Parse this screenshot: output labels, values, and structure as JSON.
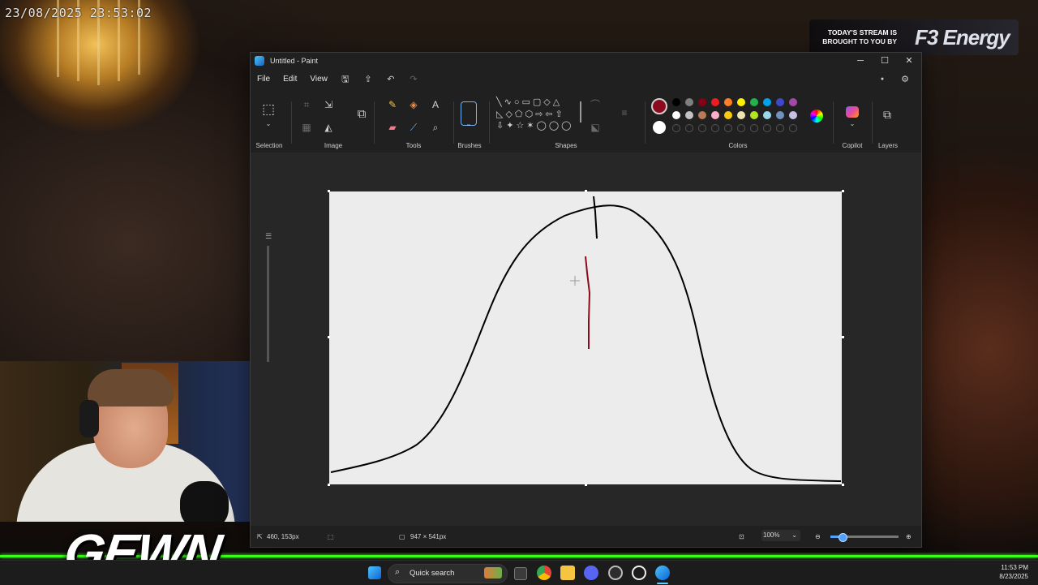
{
  "overlay": {
    "timestamp": "23/08/2025 23:53:02",
    "sponsor_text": "TODAY'S STREAM IS BROUGHT TO YOU BY",
    "sponsor_logo": "F3 Energy",
    "brand": "GEWN",
    "accent_color": "#39ff14"
  },
  "window": {
    "title": "Untitled - Paint",
    "controls": {
      "minimize": "─",
      "maximize": "☐",
      "close": "✕"
    }
  },
  "menu": {
    "items": [
      "File",
      "Edit",
      "View"
    ],
    "quick_actions": [
      "save-icon",
      "share-icon",
      "undo-icon",
      "redo-icon"
    ],
    "right": [
      "account-icon",
      "settings-icon"
    ]
  },
  "ribbon": {
    "groups": {
      "selection": "Selection",
      "image": "Image",
      "tools": "Tools",
      "brushes": "Brushes",
      "shapes": "Shapes",
      "colors": "Colors",
      "copilot": "Copilot",
      "layers": "Layers"
    },
    "active_color": "#8b0a1e",
    "secondary_color": "#ffffff",
    "palette_row1": [
      "#000000",
      "#7f7f7f",
      "#880015",
      "#ed1c24",
      "#ff7f27",
      "#fff200",
      "#22b14c",
      "#00a2e8",
      "#3f48cc",
      "#a349a4"
    ],
    "palette_row2": [
      "#ffffff",
      "#c3c3c3",
      "#b97a57",
      "#ffaec9",
      "#ffc90e",
      "#efe4b0",
      "#b5e61d",
      "#99d9ea",
      "#7092be",
      "#c8bfe7"
    ]
  },
  "status": {
    "cursor_position": "460, 153px",
    "canvas_size": "947 × 541px",
    "zoom": "100%"
  },
  "taskbar": {
    "search_label": "Quick search",
    "time": "11:53 PM",
    "date": "8/23/2025"
  }
}
